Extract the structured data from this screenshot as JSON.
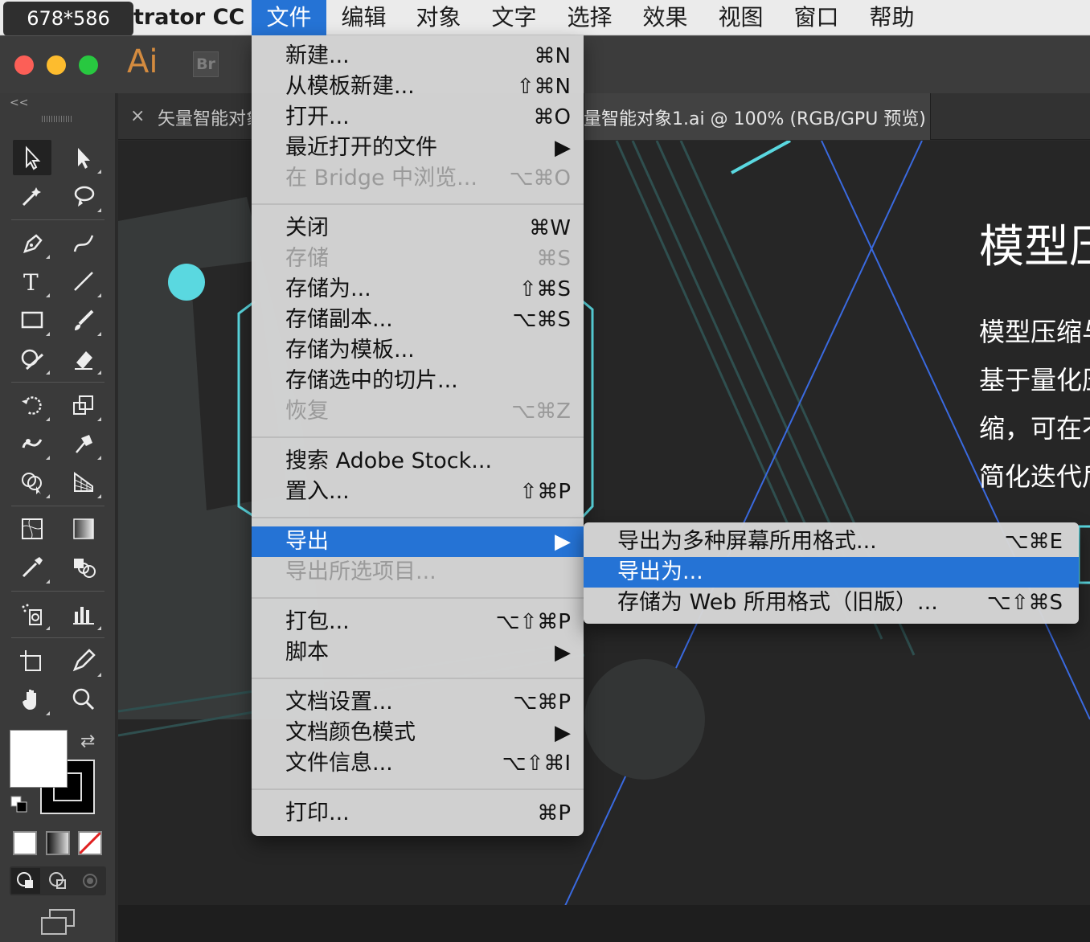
{
  "badge": "678*586",
  "menubar": {
    "app_name": "trator CC",
    "items": [
      "文件",
      "编辑",
      "对象",
      "文字",
      "选择",
      "效果",
      "视图",
      "窗口",
      "帮助"
    ],
    "active": "文件"
  },
  "app": {
    "logo": "Ai",
    "bridge_logo": "Br"
  },
  "toolbar": {
    "collapse": "<<"
  },
  "tabs": {
    "left_label": "矢量智能对象",
    "active_label": "量智能对象1.ai @ 100% (RGB/GPU 预览)",
    "close": "×"
  },
  "artboard": {
    "title": "模型压",
    "lines": [
      "模型压缩与",
      "基于量化压",
      "缩，可在不",
      "简化迭代后"
    ]
  },
  "file_menu": {
    "groups": [
      [
        {
          "label": "新建...",
          "shortcut": "⌘N",
          "disabled": false
        },
        {
          "label": "从模板新建...",
          "shortcut": "⇧⌘N",
          "disabled": false
        },
        {
          "label": "打开...",
          "shortcut": "⌘O",
          "disabled": false
        },
        {
          "label": "最近打开的文件",
          "shortcut": "▶",
          "disabled": false
        },
        {
          "label": "在 Bridge 中浏览...",
          "shortcut": "⌥⌘O",
          "disabled": true
        }
      ],
      [
        {
          "label": "关闭",
          "shortcut": "⌘W",
          "disabled": false
        },
        {
          "label": "存储",
          "shortcut": "⌘S",
          "disabled": true
        },
        {
          "label": "存储为...",
          "shortcut": "⇧⌘S",
          "disabled": false
        },
        {
          "label": "存储副本...",
          "shortcut": "⌥⌘S",
          "disabled": false
        },
        {
          "label": "存储为模板...",
          "shortcut": "",
          "disabled": false
        },
        {
          "label": "存储选中的切片...",
          "shortcut": "",
          "disabled": false
        },
        {
          "label": "恢复",
          "shortcut": "⌥⌘Z",
          "disabled": true
        }
      ],
      [
        {
          "label": "搜索 Adobe Stock...",
          "shortcut": "",
          "disabled": false
        },
        {
          "label": "置入...",
          "shortcut": "⇧⌘P",
          "disabled": false
        }
      ],
      [
        {
          "label": "导出",
          "shortcut": "▶",
          "disabled": false,
          "highlighted": true
        },
        {
          "label": "导出所选项目...",
          "shortcut": "",
          "disabled": true
        }
      ],
      [
        {
          "label": "打包...",
          "shortcut": "⌥⇧⌘P",
          "disabled": false
        },
        {
          "label": "脚本",
          "shortcut": "▶",
          "disabled": false
        }
      ],
      [
        {
          "label": "文档设置...",
          "shortcut": "⌥⌘P",
          "disabled": false
        },
        {
          "label": "文档颜色模式",
          "shortcut": "▶",
          "disabled": false
        },
        {
          "label": "文件信息...",
          "shortcut": "⌥⇧⌘I",
          "disabled": false
        }
      ],
      [
        {
          "label": "打印...",
          "shortcut": "⌘P",
          "disabled": false
        }
      ]
    ]
  },
  "export_submenu": [
    {
      "label": "导出为多种屏幕所用格式...",
      "shortcut": "⌥⌘E",
      "highlighted": false
    },
    {
      "label": "导出为...",
      "shortcut": "",
      "highlighted": true
    },
    {
      "label": "存储为 Web 所用格式（旧版）...",
      "shortcut": "⌥⇧⌘S",
      "highlighted": false
    }
  ],
  "colors": {
    "accent": "#2573d5",
    "menu_bg": "#d6d6d6",
    "canvas": "#262626",
    "cyan": "#5ad8e0",
    "ai_orange": "#d48b3f"
  },
  "tool_icons": [
    "selection-tool-icon",
    "direct-selection-tool-icon",
    "magic-wand-icon",
    "lasso-icon",
    "pen-tool-icon",
    "curvature-tool-icon",
    "type-tool-icon",
    "line-tool-icon",
    "rectangle-tool-icon",
    "paintbrush-icon",
    "shaper-tool-icon",
    "eraser-icon",
    "rotate-tool-icon",
    "scale-tool-icon",
    "warp-tool-icon",
    "puppet-warp-icon",
    "shape-builder-icon",
    "perspective-grid-icon",
    "mesh-tool-icon",
    "gradient-tool-icon",
    "eyedropper-icon",
    "blend-tool-icon",
    "symbol-sprayer-icon",
    "column-graph-icon",
    "artboard-tool-icon",
    "slice-tool-icon",
    "hand-tool-icon",
    "zoom-tool-icon"
  ]
}
